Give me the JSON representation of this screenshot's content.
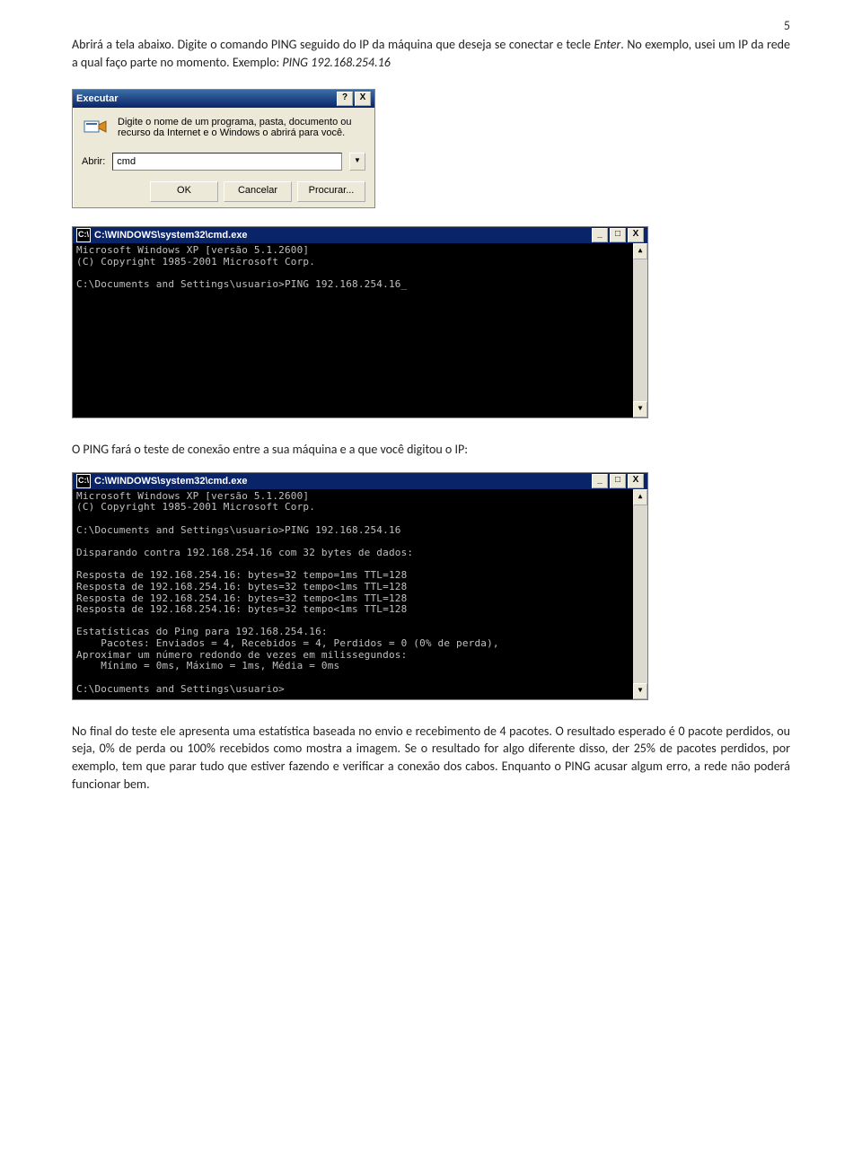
{
  "page_number": "5",
  "paragraphs": {
    "p1_a": "Abrirá a tela abaixo. Digite o comando PING seguido do IP da máquina que deseja se conectar e tecle ",
    "p1_enter": "Enter",
    "p1_b": ". No exemplo, usei um IP da rede a qual faço parte no momento. Exemplo: ",
    "p1_cmd": "PING 192.168.254.16",
    "p2": "O PING fará o teste de conexão entre a sua máquina e a que você digitou o IP:",
    "p3": "No final do teste ele apresenta uma estatística baseada no envio e recebimento de 4 pacotes. O resultado esperado é 0 pacote perdidos, ou seja, 0% de perda ou 100% recebidos como mostra a imagem. Se o resultado for algo diferente disso, der 25% de pacotes perdidos, por exemplo, tem que parar tudo que estiver fazendo e verificar a conexão dos cabos. Enquanto o PING acusar algum erro, a rede não poderá funcionar bem."
  },
  "run_dialog": {
    "title": "Executar",
    "help_btn": "?",
    "close_btn": "X",
    "desc": "Digite o nome de um programa, pasta, documento ou recurso da Internet e o Windows o abrirá para você.",
    "open_label": "Abrir:",
    "open_value": "cmd",
    "ok": "OK",
    "cancel": "Cancelar",
    "browse": "Procurar..."
  },
  "cmd1": {
    "title": "C:\\WINDOWS\\system32\\cmd.exe",
    "icon": "C:\\",
    "min": "_",
    "max": "□",
    "close": "X",
    "up": "▲",
    "down": "▼",
    "lines": "Microsoft Windows XP [versão 5.1.2600]\n(C) Copyright 1985-2001 Microsoft Corp.\n\nC:\\Documents and Settings\\usuario>PING 192.168.254.16_"
  },
  "cmd2": {
    "title": "C:\\WINDOWS\\system32\\cmd.exe",
    "icon": "C:\\",
    "min": "_",
    "max": "□",
    "close": "X",
    "up": "▲",
    "down": "▼",
    "lines": "Microsoft Windows XP [versão 5.1.2600]\n(C) Copyright 1985-2001 Microsoft Corp.\n\nC:\\Documents and Settings\\usuario>PING 192.168.254.16\n\nDisparando contra 192.168.254.16 com 32 bytes de dados:\n\nResposta de 192.168.254.16: bytes=32 tempo=1ms TTL=128\nResposta de 192.168.254.16: bytes=32 tempo<1ms TTL=128\nResposta de 192.168.254.16: bytes=32 tempo<1ms TTL=128\nResposta de 192.168.254.16: bytes=32 tempo<1ms TTL=128\n\nEstatísticas do Ping para 192.168.254.16:\n    Pacotes: Enviados = 4, Recebidos = 4, Perdidos = 0 (0% de perda),\nAproximar um número redondo de vezes em milissegundos:\n    Mínimo = 0ms, Máximo = 1ms, Média = 0ms\n\nC:\\Documents and Settings\\usuario>"
  }
}
